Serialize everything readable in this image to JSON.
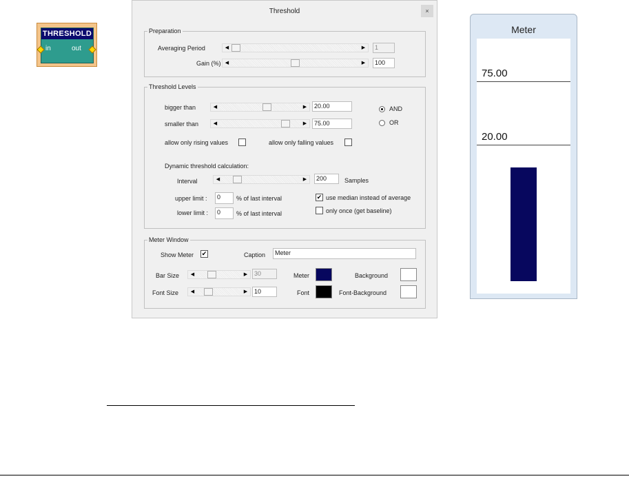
{
  "node": {
    "title": "THRESHOLD",
    "in_label": "in",
    "out_label": "out"
  },
  "dialog": {
    "title": "Threshold",
    "close_glyph": "×",
    "preparation": {
      "legend": "Preparation",
      "averaging_label": "Averaging Period",
      "averaging_value": "1",
      "averaging_position": 0.0,
      "gain_label": "Gain (%)",
      "gain_value": "100",
      "gain_position": 0.5
    },
    "levels": {
      "legend": "Threshold Levels",
      "bigger_label": "bigger than",
      "bigger_value": "20.00",
      "bigger_position": 0.6,
      "smaller_label": "smaller than",
      "smaller_value": "75.00",
      "smaller_position": 0.86,
      "and_label": "AND",
      "or_label": "OR",
      "combine_selected": "AND",
      "rising_label": "allow only rising values",
      "rising_checked": false,
      "falling_label": "allow only falling values",
      "falling_checked": false,
      "dynamic_label": "Dynamic threshold calculation:",
      "interval_label": "Interval",
      "interval_value": "200",
      "interval_position": 0.15,
      "samples_label": "Samples",
      "upper_label": "upper limit :",
      "upper_value": "0",
      "lower_label": "lower limit :",
      "lower_value": "0",
      "pct_label": "% of last interval",
      "median_label": "use median instead of average",
      "median_checked": true,
      "once_label": "only once (get baseline)",
      "once_checked": false
    },
    "meter_window": {
      "legend": "Meter Window",
      "show_label": "Show Meter",
      "show_checked": true,
      "caption_label": "Caption",
      "caption_value": "Meter",
      "barsize_label": "Bar Size",
      "barsize_value": "30",
      "barsize_position": 0.3,
      "fontsize_label": "Font Size",
      "fontsize_value": "10",
      "fontsize_position": 0.2,
      "meter_color_label": "Meter",
      "meter_color": "#07075e",
      "background_label": "Background",
      "background_color": "#ffffff",
      "font_color_label": "Font",
      "font_color": "#000000",
      "font_background_label": "Font-Background",
      "font_background_color": "#ffffff"
    }
  },
  "meter": {
    "title": "Meter",
    "upper_level": "75.00",
    "lower_level": "20.00",
    "bar_color": "#07075e"
  }
}
